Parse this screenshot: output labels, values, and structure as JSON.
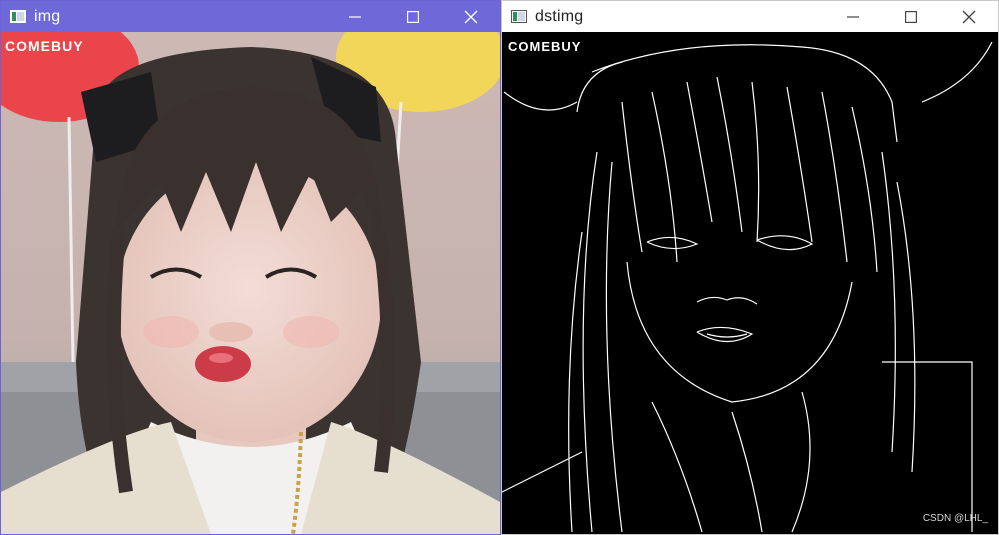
{
  "windows": [
    {
      "title": "img",
      "active": true,
      "icon": "app-window-icon",
      "controls": {
        "minimize": "minimize-icon",
        "maximize": "maximize-icon",
        "close": "close-icon"
      },
      "photo_text": "COMEBUY"
    },
    {
      "title": "dstimg",
      "active": false,
      "icon": "app-window-icon",
      "controls": {
        "minimize": "minimize-icon",
        "maximize": "maximize-icon",
        "close": "close-icon"
      },
      "edge_text": "COMEBUY",
      "watermark": "CSDN @LHL_"
    }
  ],
  "colors": {
    "active_titlebar": "#6e68d8",
    "inactive_titlebar": "#ffffff",
    "edge_background": "#000000",
    "edge_lines": "#ffffff"
  }
}
